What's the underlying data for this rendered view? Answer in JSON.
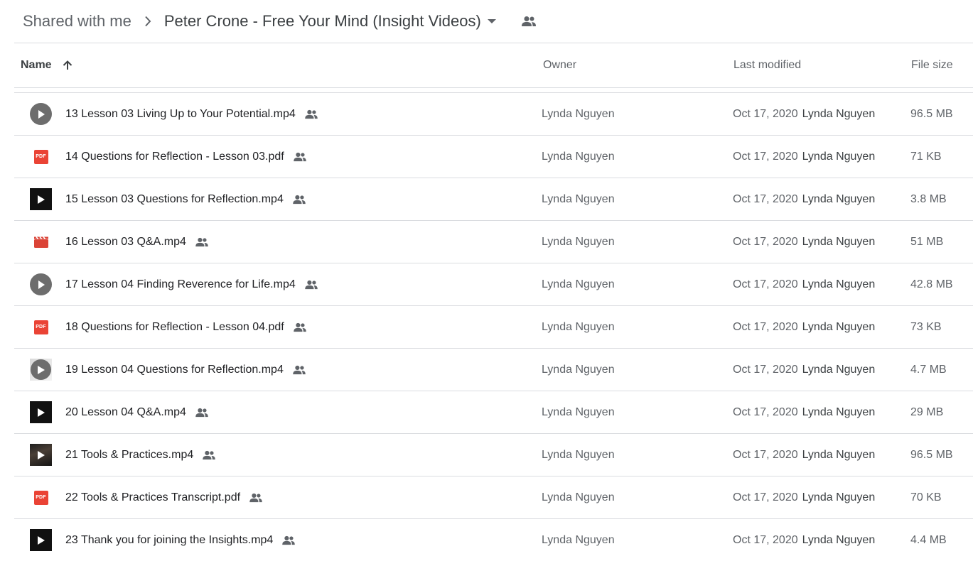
{
  "breadcrumb": {
    "root": "Shared with me",
    "current": "Peter Crone - Free Your Mind (Insight Videos)"
  },
  "columns": {
    "name": "Name",
    "owner": "Owner",
    "modified": "Last modified",
    "size": "File size"
  },
  "files": [
    {
      "name": "13 Lesson 03 Living Up to Your Potential.mp4",
      "icon": "video-circle-play-icon",
      "owner": "Lynda Nguyen",
      "date": "Oct 17, 2020",
      "modified_by": "Lynda Nguyen",
      "size": "96.5 MB"
    },
    {
      "name": "14 Questions for Reflection - Lesson 03.pdf",
      "icon": "pdf-icon",
      "owner": "Lynda Nguyen",
      "date": "Oct 17, 2020",
      "modified_by": "Lynda Nguyen",
      "size": "71 KB"
    },
    {
      "name": "15 Lesson 03 Questions for Reflection.mp4",
      "icon": "video-thumbnail-play-icon",
      "owner": "Lynda Nguyen",
      "date": "Oct 17, 2020",
      "modified_by": "Lynda Nguyen",
      "size": "3.8 MB"
    },
    {
      "name": "16 Lesson 03 Q&A.mp4",
      "icon": "film-clapper-icon",
      "owner": "Lynda Nguyen",
      "date": "Oct 17, 2020",
      "modified_by": "Lynda Nguyen",
      "size": "51 MB"
    },
    {
      "name": "17 Lesson 04 Finding Reverence for Life.mp4",
      "icon": "video-circle-play-icon",
      "owner": "Lynda Nguyen",
      "date": "Oct 17, 2020",
      "modified_by": "Lynda Nguyen",
      "size": "42.8 MB"
    },
    {
      "name": "18 Questions for Reflection - Lesson 04.pdf",
      "icon": "pdf-icon",
      "owner": "Lynda Nguyen",
      "date": "Oct 17, 2020",
      "modified_by": "Lynda Nguyen",
      "size": "73 KB"
    },
    {
      "name": "19 Lesson 04 Questions for Reflection.mp4",
      "icon": "video-thumbnail-grey-play-icon",
      "owner": "Lynda Nguyen",
      "date": "Oct 17, 2020",
      "modified_by": "Lynda Nguyen",
      "size": "4.7 MB"
    },
    {
      "name": "20 Lesson 04 Q&A.mp4",
      "icon": "video-thumbnail-play-icon",
      "owner": "Lynda Nguyen",
      "date": "Oct 17, 2020",
      "modified_by": "Lynda Nguyen",
      "size": "29 MB"
    },
    {
      "name": "21 Tools & Practices.mp4",
      "icon": "video-thumbnail-photo-play-icon",
      "owner": "Lynda Nguyen",
      "date": "Oct 17, 2020",
      "modified_by": "Lynda Nguyen",
      "size": "96.5 MB"
    },
    {
      "name": "22 Tools & Practices Transcript.pdf",
      "icon": "pdf-icon",
      "owner": "Lynda Nguyen",
      "date": "Oct 17, 2020",
      "modified_by": "Lynda Nguyen",
      "size": "70 KB"
    },
    {
      "name": "23 Thank you for joining the Insights.mp4",
      "icon": "video-thumbnail-play-icon",
      "owner": "Lynda Nguyen",
      "date": "Oct 17, 2020",
      "modified_by": "Lynda Nguyen",
      "size": "4.4 MB"
    }
  ],
  "colors": {
    "pdf": "#ea4335",
    "divider": "#dadce0",
    "secondary_text": "#5f6368"
  }
}
